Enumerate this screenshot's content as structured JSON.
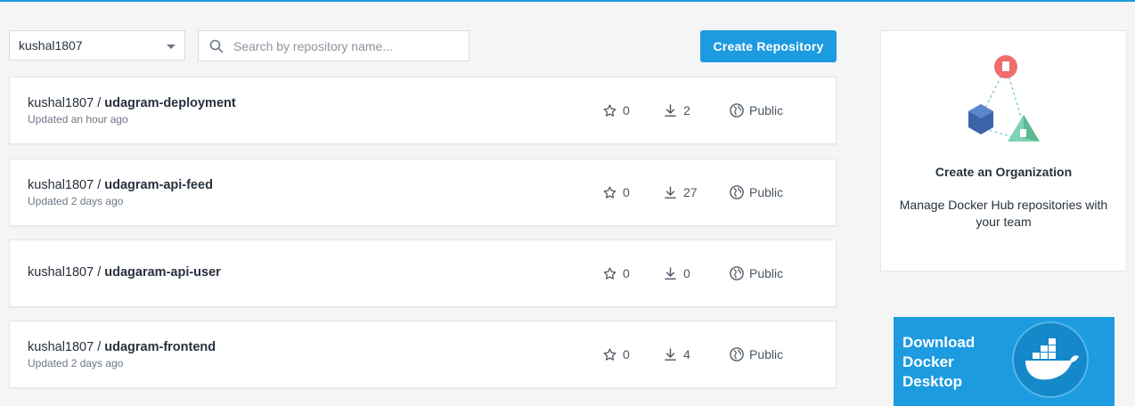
{
  "namespace": {
    "selected": "kushal1807"
  },
  "search": {
    "placeholder": "Search by repository name..."
  },
  "actions": {
    "create_label": "Create Repository"
  },
  "repos": [
    {
      "owner": "kushal1807 / ",
      "name": "udagram-deployment",
      "updated": "Updated an hour ago",
      "stars": "0",
      "pulls": "2",
      "visibility": "Public"
    },
    {
      "owner": "kushal1807 / ",
      "name": "udagram-api-feed",
      "updated": "Updated 2 days ago",
      "stars": "0",
      "pulls": "27",
      "visibility": "Public"
    },
    {
      "owner": "kushal1807 / ",
      "name": "udagaram-api-user",
      "updated": "",
      "stars": "0",
      "pulls": "0",
      "visibility": "Public"
    },
    {
      "owner": "kushal1807 / ",
      "name": "udagram-frontend",
      "updated": "Updated 2 days ago",
      "stars": "0",
      "pulls": "4",
      "visibility": "Public"
    }
  ],
  "org_card": {
    "title": "Create an Organization",
    "description": "Manage Docker Hub repositories with your team"
  },
  "promo": {
    "text": "Download Docker Desktop"
  },
  "colors": {
    "accent": "#1d9be0",
    "background": "#f5f5f5"
  },
  "icons": [
    "chevron-down-icon",
    "search-icon",
    "star-icon",
    "download-icon",
    "globe-icon",
    "docker-whale-icon"
  ]
}
